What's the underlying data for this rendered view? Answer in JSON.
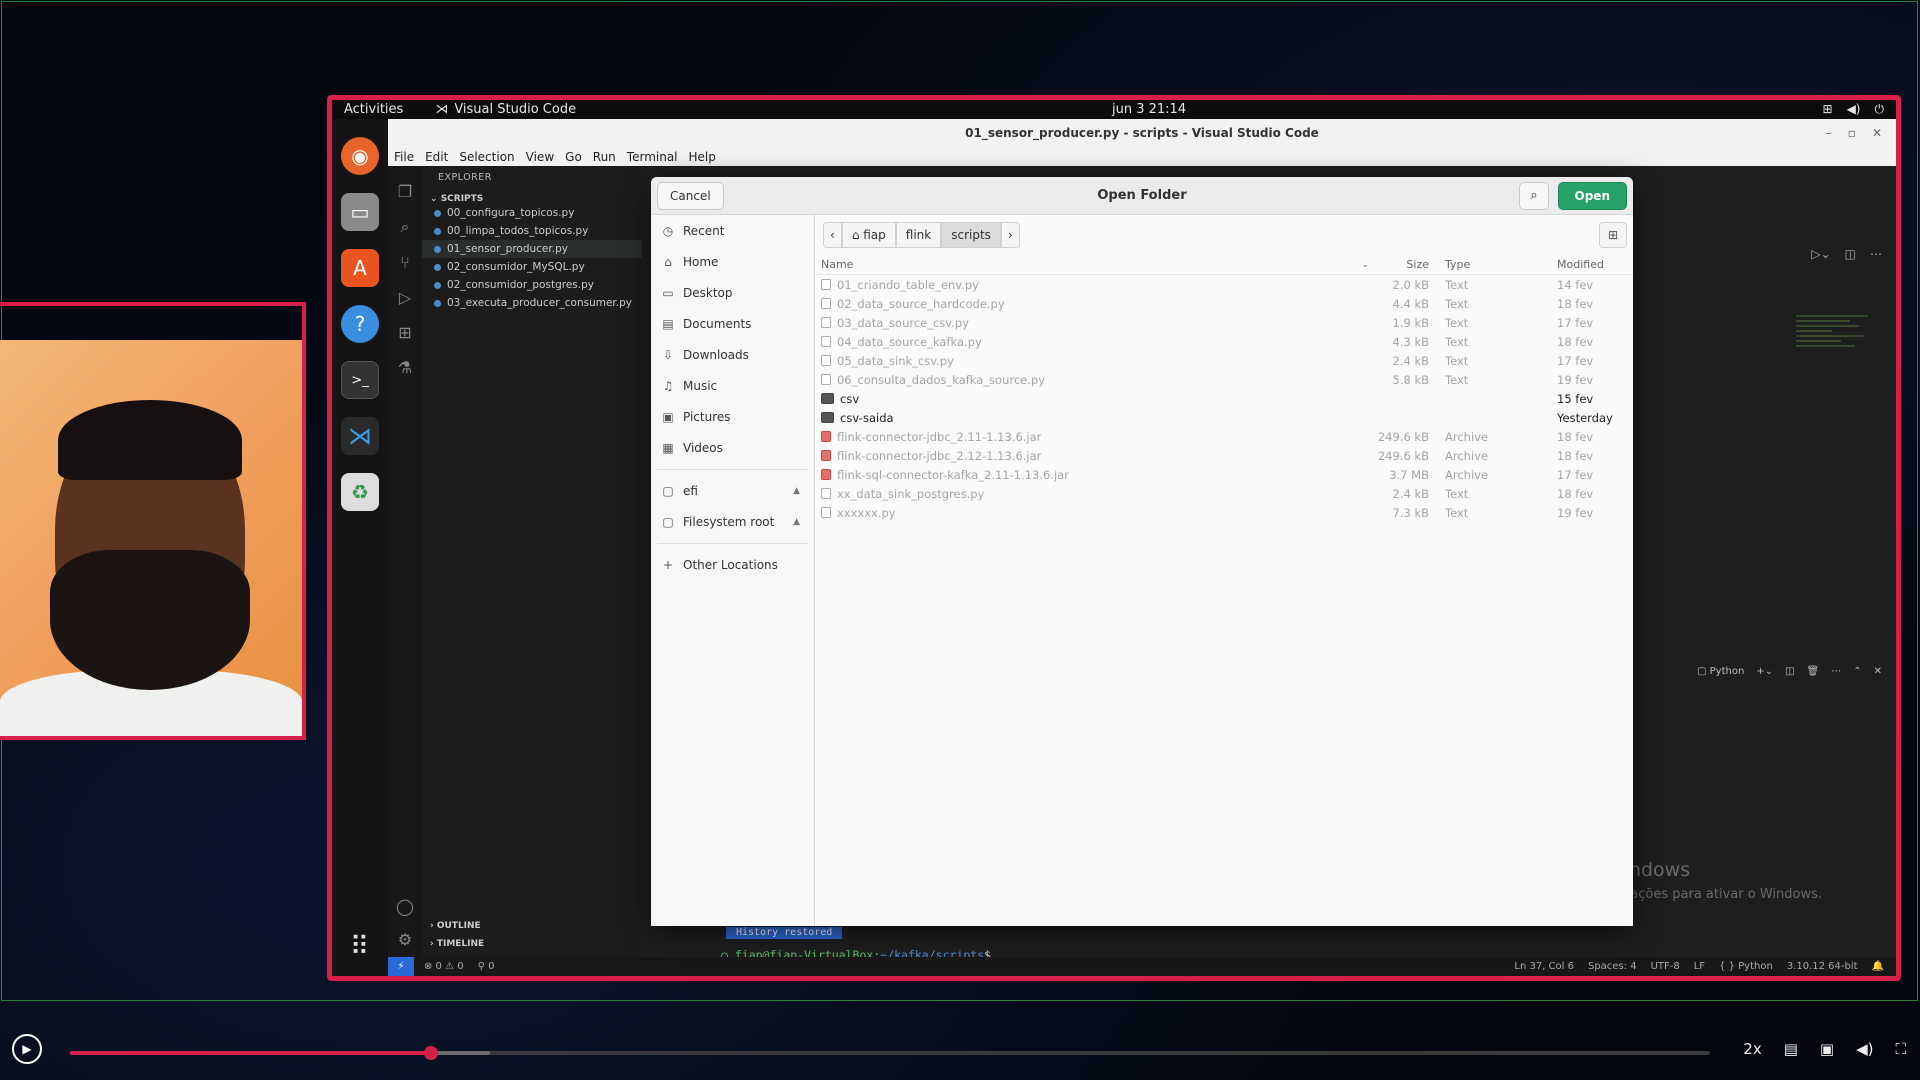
{
  "gnome": {
    "activities": "Activities",
    "app_name": "Visual Studio Code",
    "clock": "jun 3  21:14"
  },
  "vscode": {
    "title": "01_sensor_producer.py - scripts - Visual Studio Code",
    "menu": [
      "File",
      "Edit",
      "Selection",
      "View",
      "Go",
      "Run",
      "Terminal",
      "Help"
    ],
    "explorer_label": "EXPLORER",
    "section_label": "SCRIPTS",
    "files": [
      {
        "name": "00_configura_topicos.py",
        "active": false
      },
      {
        "name": "00_limpa_todos_topicos.py",
        "active": false
      },
      {
        "name": "01_sensor_producer.py",
        "active": true
      },
      {
        "name": "02_consumidor_MySQL.py",
        "active": false
      },
      {
        "name": "02_consumidor_postgres.py",
        "active": false
      },
      {
        "name": "03_executa_producer_consumer.py",
        "active": false
      }
    ],
    "outline_label": "OUTLINE",
    "timeline_label": "TIMELINE",
    "terminal_prompt": "fiap@fiap-VirtualBox:",
    "terminal_path": "~/kafka/scripts",
    "terminal_suffix": "$",
    "terminal_tag": "History restored",
    "panel_shell": "Python",
    "status_left": [
      "⊗ 0 ⚠ 0",
      "⚲ 0"
    ],
    "status_right": [
      "Ln 37, Col 6",
      "Spaces: 4",
      "UTF-8",
      "LF",
      "{ } Python",
      "3.10.12 64-bit"
    ]
  },
  "dialog": {
    "title": "Open Folder",
    "cancel_label": "Cancel",
    "open_label": "Open",
    "places": [
      {
        "label": "Recent",
        "icon": "clock-icon",
        "glyph": "◷"
      },
      {
        "label": "Home",
        "icon": "home-icon",
        "glyph": "⌂"
      },
      {
        "label": "Desktop",
        "icon": "desktop-icon",
        "glyph": "▭"
      },
      {
        "label": "Documents",
        "icon": "document-icon",
        "glyph": "▤"
      },
      {
        "label": "Downloads",
        "icon": "download-icon",
        "glyph": "⇩"
      },
      {
        "label": "Music",
        "icon": "music-icon",
        "glyph": "♫"
      },
      {
        "label": "Pictures",
        "icon": "picture-icon",
        "glyph": "▣"
      },
      {
        "label": "Videos",
        "icon": "video-icon",
        "glyph": "▦"
      }
    ],
    "devices": [
      {
        "label": "efi",
        "icon": "drive-icon",
        "glyph": "▢"
      },
      {
        "label": "Filesystem root",
        "icon": "drive-icon",
        "glyph": "▢"
      }
    ],
    "other_locations": "Other Locations",
    "path": [
      "fiap",
      "flink",
      "scripts"
    ],
    "columns": {
      "name": "Name",
      "size": "Size",
      "type": "Type",
      "modified": "Modified"
    },
    "files": [
      {
        "name": "01_criando_table_env.py",
        "size": "2.0 kB",
        "type": "Text",
        "modified": "14 fev",
        "kind": "text"
      },
      {
        "name": "02_data_source_hardcode.py",
        "size": "4.4 kB",
        "type": "Text",
        "modified": "18 fev",
        "kind": "text"
      },
      {
        "name": "03_data_source_csv.py",
        "size": "1.9 kB",
        "type": "Text",
        "modified": "17 fev",
        "kind": "text"
      },
      {
        "name": "04_data_source_kafka.py",
        "size": "4.3 kB",
        "type": "Text",
        "modified": "18 fev",
        "kind": "text"
      },
      {
        "name": "05_data_sink_csv.py",
        "size": "2.4 kB",
        "type": "Text",
        "modified": "17 fev",
        "kind": "text"
      },
      {
        "name": "06_consulta_dados_kafka_source.py",
        "size": "5.8 kB",
        "type": "Text",
        "modified": "19 fev",
        "kind": "text"
      },
      {
        "name": "csv",
        "size": "",
        "type": "",
        "modified": "15 fev",
        "kind": "folder"
      },
      {
        "name": "csv-saida",
        "size": "",
        "type": "",
        "modified": "Yesterday",
        "kind": "folder"
      },
      {
        "name": "flink-connector-jdbc_2.11-1.13.6.jar",
        "size": "249.6 kB",
        "type": "Archive",
        "modified": "18 fev",
        "kind": "archive"
      },
      {
        "name": "flink-connector-jdbc_2.12-1.13.6.jar",
        "size": "249.6 kB",
        "type": "Archive",
        "modified": "18 fev",
        "kind": "archive"
      },
      {
        "name": "flink-sql-connector-kafka_2.11-1.13.6.jar",
        "size": "3.7 MB",
        "type": "Archive",
        "modified": "17 fev",
        "kind": "archive"
      },
      {
        "name": "xx_data_sink_postgres.py",
        "size": "2.4 kB",
        "type": "Text",
        "modified": "18 fev",
        "kind": "text"
      },
      {
        "name": "xxxxxx.py",
        "size": "7.3 kB",
        "type": "Text",
        "modified": "19 fev",
        "kind": "text"
      }
    ]
  },
  "watermark": {
    "line1": "Ativar o Windows",
    "line2": "Acesse Configurações para ativar o Windows."
  },
  "player": {
    "speed": "2x",
    "progress_fraction": 0.22
  }
}
